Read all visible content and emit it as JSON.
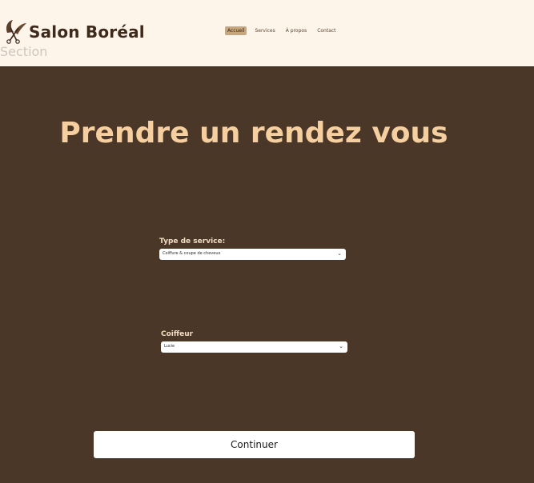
{
  "brand": {
    "name": "Salon Boréal",
    "section_label": "Section"
  },
  "nav": {
    "items": [
      {
        "label": "Accueil",
        "active": true
      },
      {
        "label": "Services",
        "active": false
      },
      {
        "label": "À propos",
        "active": false
      },
      {
        "label": "Contact",
        "active": false
      }
    ]
  },
  "main": {
    "title": "Prendre un rendez vous",
    "service": {
      "label": "Type de service:",
      "value": "Coiffure & coupe de cheveux"
    },
    "stylist": {
      "label": "Coiffeur",
      "value": "Lucie"
    },
    "continue_label": "Continuer"
  },
  "colors": {
    "header_bg": "#fdf5ea",
    "page_bg": "#4a3728",
    "title": "#f6cfa0",
    "nav_active": "#c9a77d"
  }
}
